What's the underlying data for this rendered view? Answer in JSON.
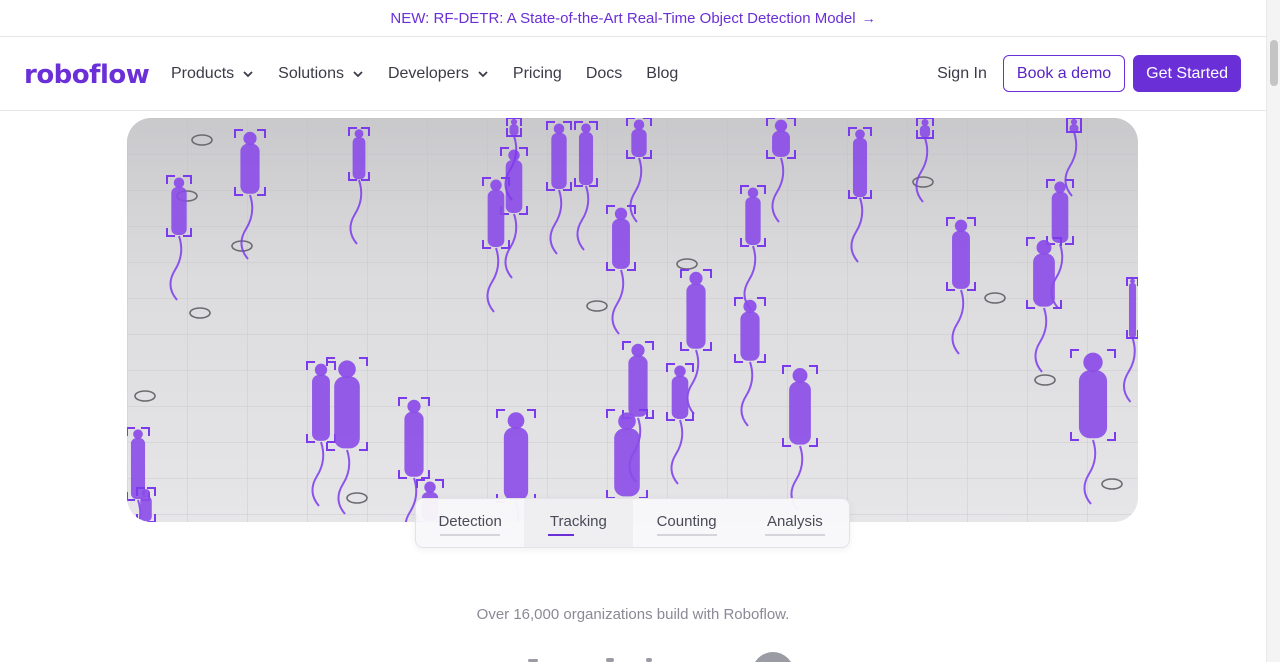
{
  "announcement": {
    "text": "NEW: RF-DETR: A State-of-the-Art Real-Time Object Detection Model",
    "arrow": "→"
  },
  "brand": {
    "logo": "roboflow",
    "accent": "#6a2fd6"
  },
  "nav": {
    "items": [
      {
        "label": "Products",
        "dropdown": true
      },
      {
        "label": "Solutions",
        "dropdown": true
      },
      {
        "label": "Developers",
        "dropdown": true
      },
      {
        "label": "Pricing",
        "dropdown": false
      },
      {
        "label": "Docs",
        "dropdown": false
      },
      {
        "label": "Blog",
        "dropdown": false
      }
    ],
    "sign_in": "Sign In",
    "book_demo": "Book a demo",
    "get_started": "Get Started"
  },
  "demo": {
    "tabs": [
      {
        "label": "Detection",
        "active": false
      },
      {
        "label": "Tracking",
        "active": true
      },
      {
        "label": "Counting",
        "active": false
      },
      {
        "label": "Analysis",
        "active": false
      }
    ]
  },
  "social_proof": "Over 16,000 organizations build with Roboflow.",
  "icons": {
    "chevron": "chevron-down-icon",
    "arrow": "arrow-right-icon"
  }
}
